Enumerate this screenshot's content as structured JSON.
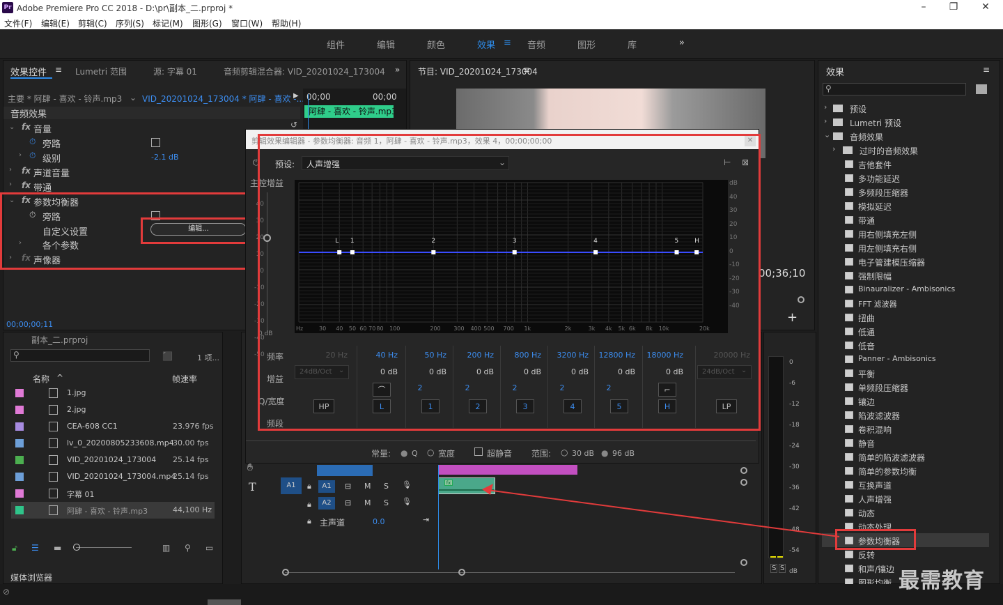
{
  "app": {
    "title": "Adobe Premiere Pro CC 2018 - D:\\pr\\副本_二.prproj *",
    "logo": "Pr"
  },
  "menu": [
    "文件(F)",
    "编辑(E)",
    "剪辑(C)",
    "序列(S)",
    "标记(M)",
    "图形(G)",
    "窗口(W)",
    "帮助(H)"
  ],
  "workspaces": {
    "items": [
      "组件",
      "编辑",
      "颜色",
      "效果",
      "音频",
      "图形",
      "库"
    ],
    "active": "效果",
    "more": "»"
  },
  "effect_controls": {
    "tabs": [
      "效果控件",
      "Lumetri 范围",
      "源: 字幕 01",
      "音频剪辑混合器: VID_20201024_173004"
    ],
    "master": "主要 * 阿肆 - 喜欢 - 铃声.mp3",
    "clip": "VID_20201024_173004 * 阿肆 - 喜欢 -...",
    "tc_start": "00;00",
    "tc_end": "00;00",
    "clip_label": "阿肆 - 喜欢 - 铃声.mp3",
    "section": "音频效果",
    "rows": {
      "volume": "音量",
      "bypass": "旁路",
      "level": "级别",
      "level_value": "-2.1 dB",
      "channel_volume": "声道音量",
      "bandpass": "带通",
      "param_eq": "参数均衡器",
      "bypass2": "旁路",
      "custom": "自定义设置",
      "edit_btn": "编辑...",
      "params": "各个参数",
      "panner": "声像器"
    },
    "timecode": "00;00;00;11"
  },
  "program": {
    "title": "节目: VID_20201024_173004",
    "timecode": "00;36;10"
  },
  "eq_dialog": {
    "title": "剪辑效果编辑器 - 参数均衡器: 音频 1，阿肆 - 喜欢 - 铃声.mp3，效果 4，00;00;00;00",
    "preset_label": "预设:",
    "preset_value": "人声增强",
    "master_gain": "主控增益",
    "left_scale": [
      "40",
      "30",
      "20",
      "10",
      "0",
      "-10",
      "-20",
      "-30",
      "-40",
      "-50"
    ],
    "left_bottom": "0 dB",
    "right_scale": [
      "dB",
      "40",
      "30",
      "20",
      "10",
      "0",
      "-10",
      "-20",
      "-30",
      "-40"
    ],
    "freq_axis": [
      "Hz",
      "30",
      "40",
      "50",
      "60",
      "70",
      "80",
      "100",
      "200",
      "300",
      "400",
      "500",
      "700",
      "1k",
      "2k",
      "3k",
      "4k",
      "5k",
      "6k",
      "8k",
      "10k",
      "20k"
    ],
    "points": [
      "L",
      "1",
      "2",
      "3",
      "4",
      "5",
      "H"
    ],
    "row_labels": [
      "频率",
      "增益",
      "Q/宽度",
      "频段"
    ],
    "bands": [
      {
        "freq": "20 Hz",
        "gain": "24dB/Oct",
        "q": "",
        "btn": "HP",
        "on": false
      },
      {
        "freq": "40 Hz",
        "gain": "0 dB",
        "q": "",
        "btn": "L",
        "on": true
      },
      {
        "freq": "50 Hz",
        "gain": "0 dB",
        "q": "2",
        "btn": "1",
        "on": true
      },
      {
        "freq": "200 Hz",
        "gain": "0 dB",
        "q": "2",
        "btn": "2",
        "on": true
      },
      {
        "freq": "800 Hz",
        "gain": "0 dB",
        "q": "2",
        "btn": "3",
        "on": true
      },
      {
        "freq": "3200 Hz",
        "gain": "0 dB",
        "q": "2",
        "btn": "4",
        "on": true
      },
      {
        "freq": "12800 Hz",
        "gain": "0 dB",
        "q": "2",
        "btn": "5",
        "on": true
      },
      {
        "freq": "18000 Hz",
        "gain": "0 dB",
        "q": "",
        "btn": "H",
        "on": true
      },
      {
        "freq": "20000 Hz",
        "gain": "24dB/Oct",
        "q": "",
        "btn": "LP",
        "on": false
      }
    ],
    "footer": {
      "constant": "常量:",
      "q": "Q",
      "width": "宽度",
      "ultra": "超静音",
      "range": "范围:",
      "r30": "30 dB",
      "r96": "96 dB"
    }
  },
  "project": {
    "title": "副本_二.prproj",
    "count": "1 项...",
    "col_name": "名称",
    "col_fps": "帧速率",
    "rows": [
      {
        "name": "1.jpg",
        "fps": "",
        "color": "#e07ad6"
      },
      {
        "name": "2.jpg",
        "fps": "",
        "color": "#e07ad6"
      },
      {
        "name": "CEA-608 CC1",
        "fps": "23.976 fps",
        "color": "#a78be0"
      },
      {
        "name": "lv_0_20200805233608.mp4",
        "fps": "30.00 fps",
        "color": "#6d9fd8"
      },
      {
        "name": "VID_20201024_173004",
        "fps": "25.14 fps",
        "color": "#4caf50"
      },
      {
        "name": "VID_20201024_173004.mp4",
        "fps": "25.14 fps",
        "color": "#6d9fd8"
      },
      {
        "name": "字幕 01",
        "fps": "",
        "color": "#e07ad6"
      },
      {
        "name": "阿肆 - 喜欢 - 铃声.mp3",
        "fps": "44,100 Hz",
        "color": "#2fc48a"
      }
    ],
    "media_browser": "媒体浏览器"
  },
  "timeline": {
    "tracks": [
      "A1",
      "A2"
    ],
    "master": "主声道",
    "master_val": "0.0",
    "tools": [
      "T"
    ]
  },
  "effects_panel": {
    "title": "效果",
    "folders": [
      "预设",
      "Lumetri 预设",
      "音频效果",
      "过时的音频效果"
    ],
    "items": [
      "吉他套件",
      "多功能延迟",
      "多频段压缩器",
      "模拟延迟",
      "带通",
      "用右侧填充左侧",
      "用左侧填充右侧",
      "电子管建模压缩器",
      "强制限幅",
      "Binauralizer - Ambisonics",
      "FFT 滤波器",
      "扭曲",
      "低通",
      "低音",
      "Panner - Ambisonics",
      "平衡",
      "单频段压缩器",
      "镶边",
      "陷波滤波器",
      "卷积混响",
      "静音",
      "简单的陷波滤波器",
      "简单的参数均衡",
      "互换声道",
      "人声增强",
      "动态",
      "动态处理",
      "参数均衡器",
      "反转",
      "和声/镶边",
      "图形均衡"
    ],
    "highlight": "参数均衡器"
  },
  "meter": {
    "scale": [
      "0",
      "-6",
      "-12",
      "-18",
      "-24",
      "-30",
      "-36",
      "-42",
      "-48",
      "-54",
      "dB"
    ],
    "ss": [
      "S",
      "S"
    ]
  },
  "watermark": "最需教育",
  "colors": {
    "accent": "#2d8ceb",
    "red": "#e23b3b",
    "clip_green": "#2fcd8a",
    "clip_pink": "#c24fc0"
  }
}
